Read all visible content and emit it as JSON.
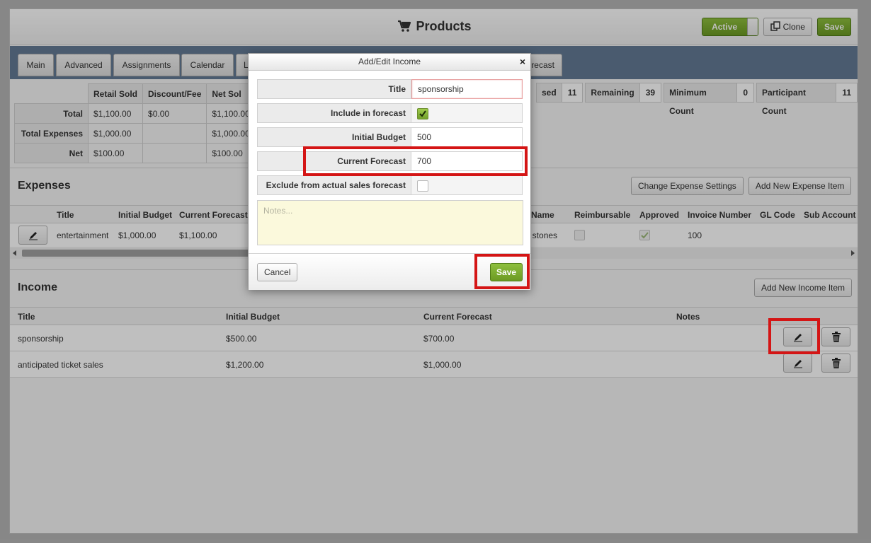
{
  "header": {
    "title": "Products",
    "active_label": "Active",
    "clone_label": "Clone",
    "save_label": "Save"
  },
  "tabs": [
    "Main",
    "Advanced",
    "Assignments",
    "Calendar",
    "L",
    "recast"
  ],
  "summary": {
    "headers": [
      "Retail Sold",
      "Discount/Fee",
      "Net Sol"
    ],
    "rows": [
      {
        "label": "Total",
        "values": [
          "$1,100.00",
          "$0.00",
          "$1,100.00"
        ]
      },
      {
        "label": "Total Expenses",
        "values": [
          "$1,000.00",
          "",
          "$1,000.00"
        ]
      },
      {
        "label": "Net",
        "values": [
          "$100.00",
          "",
          "$100.00"
        ]
      }
    ]
  },
  "stats": [
    {
      "label": "sed",
      "value": "11"
    },
    {
      "label": "Remaining",
      "value": "39"
    },
    {
      "label": "Minimum Count",
      "value": "0"
    },
    {
      "label": "Participant Count",
      "value": "11"
    }
  ],
  "expenses": {
    "title": "Expenses",
    "change_settings_label": "Change Expense Settings",
    "add_label": "Add New Expense Item",
    "columns": [
      "Title",
      "Initial Budget",
      "Current Forecast",
      "Name",
      "Reimbursable",
      "Approved",
      "Invoice Number",
      "GL Code",
      "Sub Account"
    ],
    "row": {
      "title": "entertainment",
      "initial_budget": "$1,000.00",
      "current_forecast": "$1,100.00",
      "name": "ng stones",
      "invoice_number": "100"
    }
  },
  "income": {
    "title": "Income",
    "add_label": "Add New Income Item",
    "columns": [
      "Title",
      "Initial Budget",
      "Current Forecast",
      "Notes"
    ],
    "rows": [
      {
        "title": "sponsorship",
        "initial_budget": "$500.00",
        "current_forecast": "$700.00"
      },
      {
        "title": "anticipated ticket sales",
        "initial_budget": "$1,200.00",
        "current_forecast": "$1,000.00"
      }
    ]
  },
  "modal": {
    "title": "Add/Edit Income",
    "close": "×",
    "fields": {
      "title_label": "Title",
      "title_value": "sponsorship",
      "include_label": "Include in forecast",
      "initial_budget_label": "Initial Budget",
      "initial_budget_value": "500",
      "current_forecast_label": "Current Forecast",
      "current_forecast_value": "700",
      "exclude_label": "Exclude from actual sales forecast",
      "notes_placeholder": "Notes..."
    },
    "cancel_label": "Cancel",
    "save_label": "Save"
  },
  "colors": {
    "accent_green": "#7aab2e",
    "tab_bar": "#637a94",
    "highlight": "#d41515",
    "notes_bg": "#fbf9dc"
  }
}
